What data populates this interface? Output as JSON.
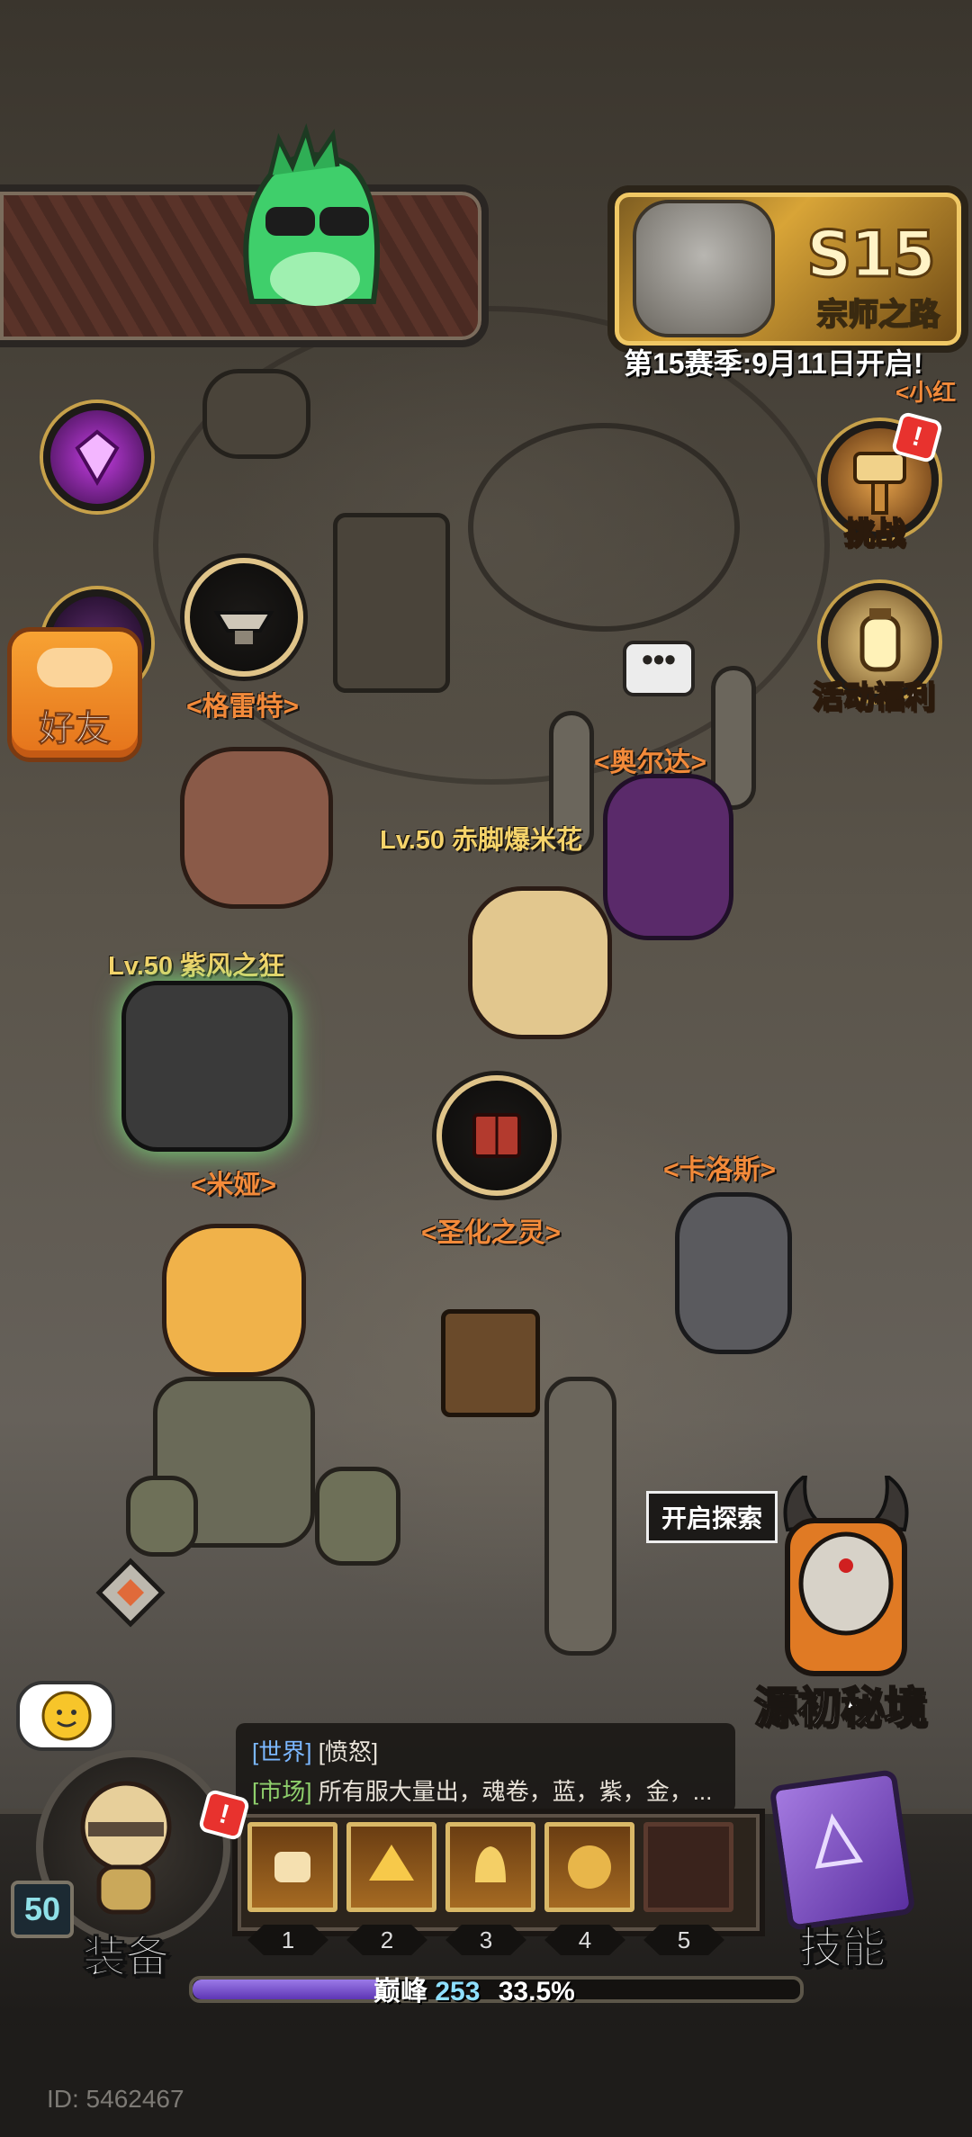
{
  "season": {
    "badge": "S15",
    "title": "宗师之路",
    "note": "第15赛季:9月11日开启!"
  },
  "side_buttons": {
    "challenge": "挑战",
    "event_rewards": "活动福利",
    "friends": "好友"
  },
  "npcs": {
    "gret": "<格雷特>",
    "aoerda": "<奥尔达>",
    "mia": "<米娅>",
    "shenghua": "<圣化之灵>",
    "kaluosi": "<卡洛斯>",
    "partial_right": "<小红"
  },
  "players": {
    "p1": "Lv.50 赤脚爆米花",
    "p2": "Lv.50 紫风之狂"
  },
  "explore": {
    "tip": "开启探索",
    "portal_label": "源初秘境"
  },
  "chat": {
    "line1_channel": "[世界]",
    "line1_text": "[愤怒]",
    "line2_channel": "[市场]",
    "line2_text": "所有服大量出，魂卷，蓝，紫，金，..."
  },
  "bottom": {
    "level": "50",
    "equip_label": "装备",
    "skills_label": "技能",
    "slot_numbers": [
      "1",
      "2",
      "3",
      "4",
      "5"
    ],
    "rank": "巅峰",
    "rank_value": "253",
    "progress_text": "33.5%",
    "progress": 0.335
  },
  "footer": {
    "user_id": "ID: 5462467"
  },
  "colors": {
    "npc_name": "#f28a3a",
    "player_name": "#f5d36a",
    "xp_fill": "#7b55d0"
  }
}
